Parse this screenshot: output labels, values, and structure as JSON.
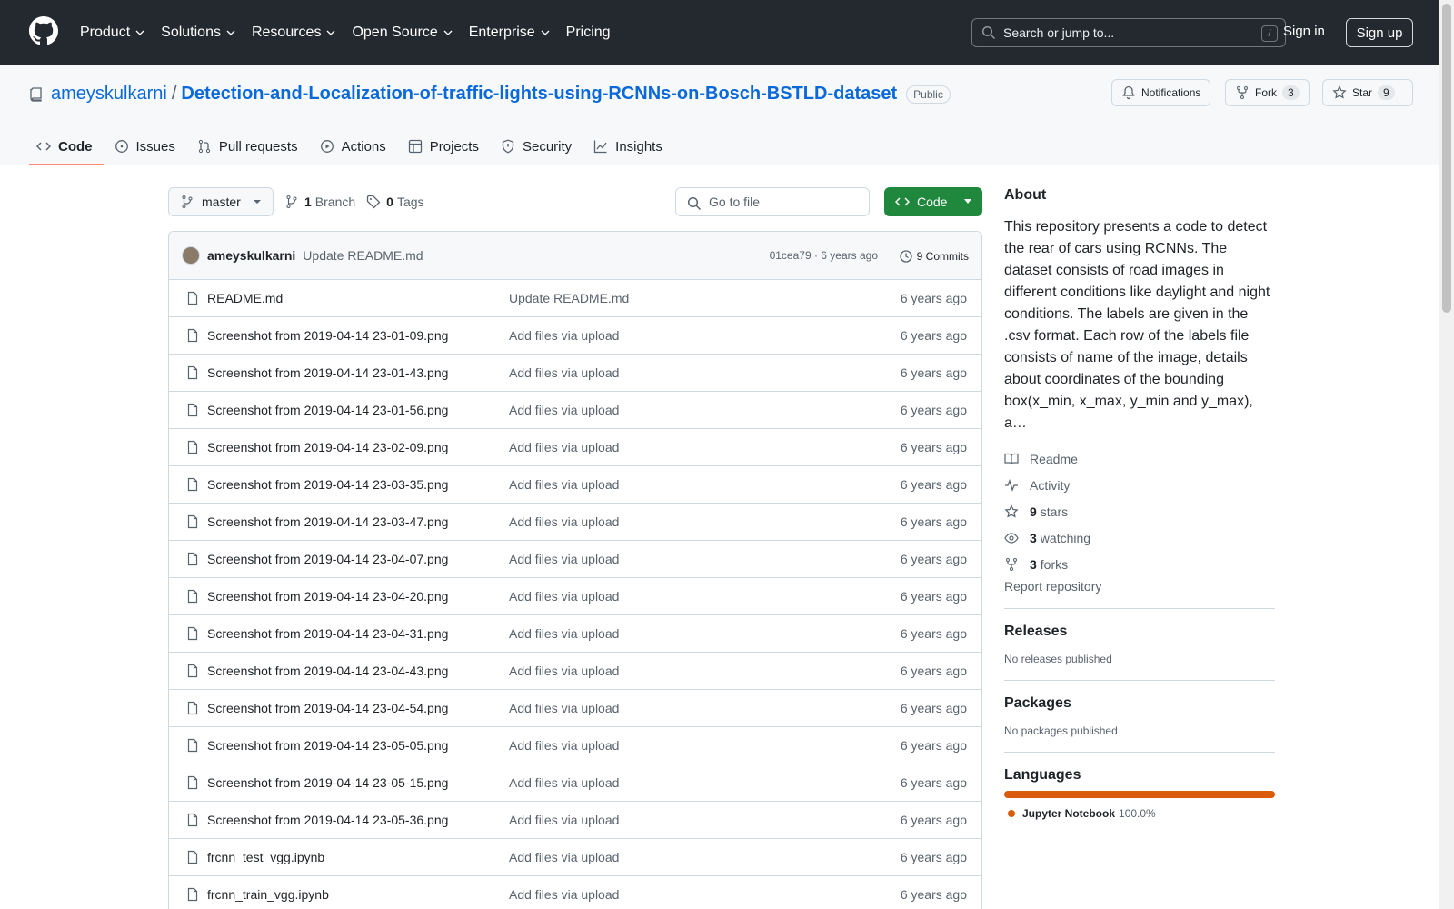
{
  "header": {
    "logo_icon": "github-logo-icon",
    "nav": [
      "Product",
      "Solutions",
      "Resources",
      "Open Source",
      "Enterprise",
      "Pricing"
    ],
    "search_placeholder": "Search or jump to...",
    "search_shortcut": "/",
    "sign_in": "Sign in",
    "sign_up": "Sign up"
  },
  "repo": {
    "owner": "ameyskulkarni",
    "separator": "/",
    "name": "Detection-and-Localization-of-traffic-lights-using-RCNNs-on-Bosch-BSTLD-dataset",
    "visibility": "Public",
    "notifications_label": "Notifications",
    "fork_label": "Fork",
    "fork_count": "3",
    "star_label": "Star",
    "star_count": "9"
  },
  "tabs": [
    {
      "label": "Code",
      "icon": "code-icon"
    },
    {
      "label": "Issues",
      "icon": "issue-icon"
    },
    {
      "label": "Pull requests",
      "icon": "pull-request-icon"
    },
    {
      "label": "Actions",
      "icon": "play-icon"
    },
    {
      "label": "Projects",
      "icon": "table-icon"
    },
    {
      "label": "Security",
      "icon": "shield-icon"
    },
    {
      "label": "Insights",
      "icon": "graph-icon"
    }
  ],
  "branch": {
    "name": "master",
    "branches_count": "1",
    "branches_label": "Branch",
    "tags_count": "0",
    "tags_label": "Tags",
    "goto_placeholder": "Go to file",
    "code_label": "Code"
  },
  "commit": {
    "author": "ameyskulkarni",
    "message": "Update README.md",
    "hash_time": "01cea79 · 6 years ago",
    "count_label": "9 Commits"
  },
  "files": [
    {
      "name": "README.md",
      "message": "Update README.md",
      "age": "6 years ago"
    },
    {
      "name": "Screenshot from 2019-04-14 23-01-09.png",
      "message": "Add files via upload",
      "age": "6 years ago"
    },
    {
      "name": "Screenshot from 2019-04-14 23-01-43.png",
      "message": "Add files via upload",
      "age": "6 years ago"
    },
    {
      "name": "Screenshot from 2019-04-14 23-01-56.png",
      "message": "Add files via upload",
      "age": "6 years ago"
    },
    {
      "name": "Screenshot from 2019-04-14 23-02-09.png",
      "message": "Add files via upload",
      "age": "6 years ago"
    },
    {
      "name": "Screenshot from 2019-04-14 23-03-35.png",
      "message": "Add files via upload",
      "age": "6 years ago"
    },
    {
      "name": "Screenshot from 2019-04-14 23-03-47.png",
      "message": "Add files via upload",
      "age": "6 years ago"
    },
    {
      "name": "Screenshot from 2019-04-14 23-04-07.png",
      "message": "Add files via upload",
      "age": "6 years ago"
    },
    {
      "name": "Screenshot from 2019-04-14 23-04-20.png",
      "message": "Add files via upload",
      "age": "6 years ago"
    },
    {
      "name": "Screenshot from 2019-04-14 23-04-31.png",
      "message": "Add files via upload",
      "age": "6 years ago"
    },
    {
      "name": "Screenshot from 2019-04-14 23-04-43.png",
      "message": "Add files via upload",
      "age": "6 years ago"
    },
    {
      "name": "Screenshot from 2019-04-14 23-04-54.png",
      "message": "Add files via upload",
      "age": "6 years ago"
    },
    {
      "name": "Screenshot from 2019-04-14 23-05-05.png",
      "message": "Add files via upload",
      "age": "6 years ago"
    },
    {
      "name": "Screenshot from 2019-04-14 23-05-15.png",
      "message": "Add files via upload",
      "age": "6 years ago"
    },
    {
      "name": "Screenshot from 2019-04-14 23-05-36.png",
      "message": "Add files via upload",
      "age": "6 years ago"
    },
    {
      "name": "frcnn_test_vgg.ipynb",
      "message": "Add files via upload",
      "age": "6 years ago"
    },
    {
      "name": "frcnn_train_vgg.ipynb",
      "message": "Add files via upload",
      "age": "6 years ago"
    }
  ],
  "sidebar": {
    "about_title": "About",
    "about_text": "This repository presents a code to detect the rear of cars using RCNNs. The dataset consists of road images in different conditions like daylight and night conditions. The labels are given in the .csv format. Each row of the labels file consists of name of the image, details about coordinates of the bounding box(x_min, x_max, y_min and y_max), a…",
    "readme": "Readme",
    "activity": "Activity",
    "stars_count": "9",
    "stars_label": "stars",
    "watching_count": "3",
    "watching_label": "watching",
    "forks_count": "3",
    "forks_label": "forks",
    "report": "Report repository",
    "releases_title": "Releases",
    "releases_text": "No releases published",
    "packages_title": "Packages",
    "packages_text": "No packages published",
    "languages_title": "Languages",
    "language_name": "Jupyter Notebook",
    "language_pct": "100.0%",
    "language_color": "#DA5B0B"
  },
  "colors": {
    "header_bg": "#24292f",
    "link": "#0969da",
    "code_button": "#1f883d",
    "active_tab": "#fd8c73"
  }
}
